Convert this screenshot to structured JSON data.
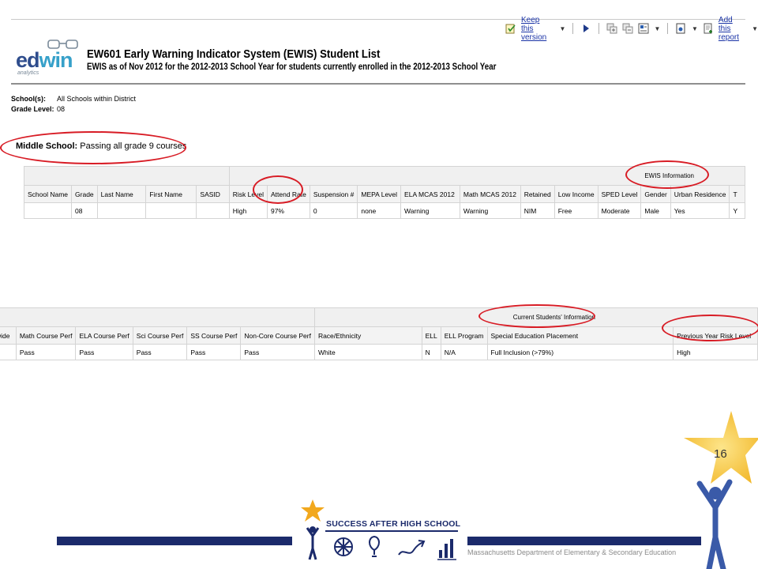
{
  "toolbar": {
    "keep_version": "Keep this version",
    "add_report": "Add this report"
  },
  "header": {
    "logo_text_e": "ed",
    "logo_text_w": "win",
    "logo_sub": "analytics",
    "title": "EW601 Early Warning Indicator System (EWIS) Student List",
    "subtitle": "EWIS as of Nov 2012 for the 2012-2013 School Year for students currently enrolled in the 2012-2013 School Year"
  },
  "params": {
    "school_label": "School(s):",
    "school_value": "All Schools within District",
    "grade_label": "Grade Level:",
    "grade_value": "08"
  },
  "section": {
    "bold": "Middle School:",
    "rest": "Passing all grade 9 courses"
  },
  "table1": {
    "group_label": "EWIS Information",
    "headers": [
      "School Name",
      "Grade",
      "Last Name",
      "First Name",
      "SASID",
      "Risk Level",
      "Attend Rate",
      "Suspension #",
      "MEPA Level",
      "ELA MCAS 2012",
      "Math MCAS 2012",
      "Retained",
      "Low Income",
      "SPED Level",
      "Gender",
      "Urban Residence",
      "T"
    ],
    "row": [
      "",
      "08",
      "",
      "",
      "",
      "High",
      "97%",
      "0",
      "none",
      "Warning",
      "Warning",
      "NIM",
      "Free",
      "Moderate",
      "Male",
      "Yes",
      "Y"
    ]
  },
  "table2": {
    "group_label": "Current Students' Information",
    "headers": [
      "wide",
      "Math Course Perf",
      "ELA Course Perf",
      "Sci Course Perf",
      "SS Course Perf",
      "Non-Core Course Perf",
      "Race/Ethnicity",
      "ELL",
      "ELL Program",
      "Special Education Placement",
      "Previous Year Risk Level"
    ],
    "row": [
      "",
      "Pass",
      "Pass",
      "Pass",
      "Pass",
      "Pass",
      "White",
      "N",
      "N/A",
      "Full Inclusion (>79%)",
      "High"
    ]
  },
  "footer": {
    "brand": "SUCCESS AFTER HIGH SCHOOL",
    "agency": "Massachusetts Department of Elementary & Secondary Education",
    "page_number": "16"
  },
  "colors": {
    "annotation": "#d81c25",
    "brand_navy": "#1b2a6b",
    "star": "#f7c531"
  }
}
